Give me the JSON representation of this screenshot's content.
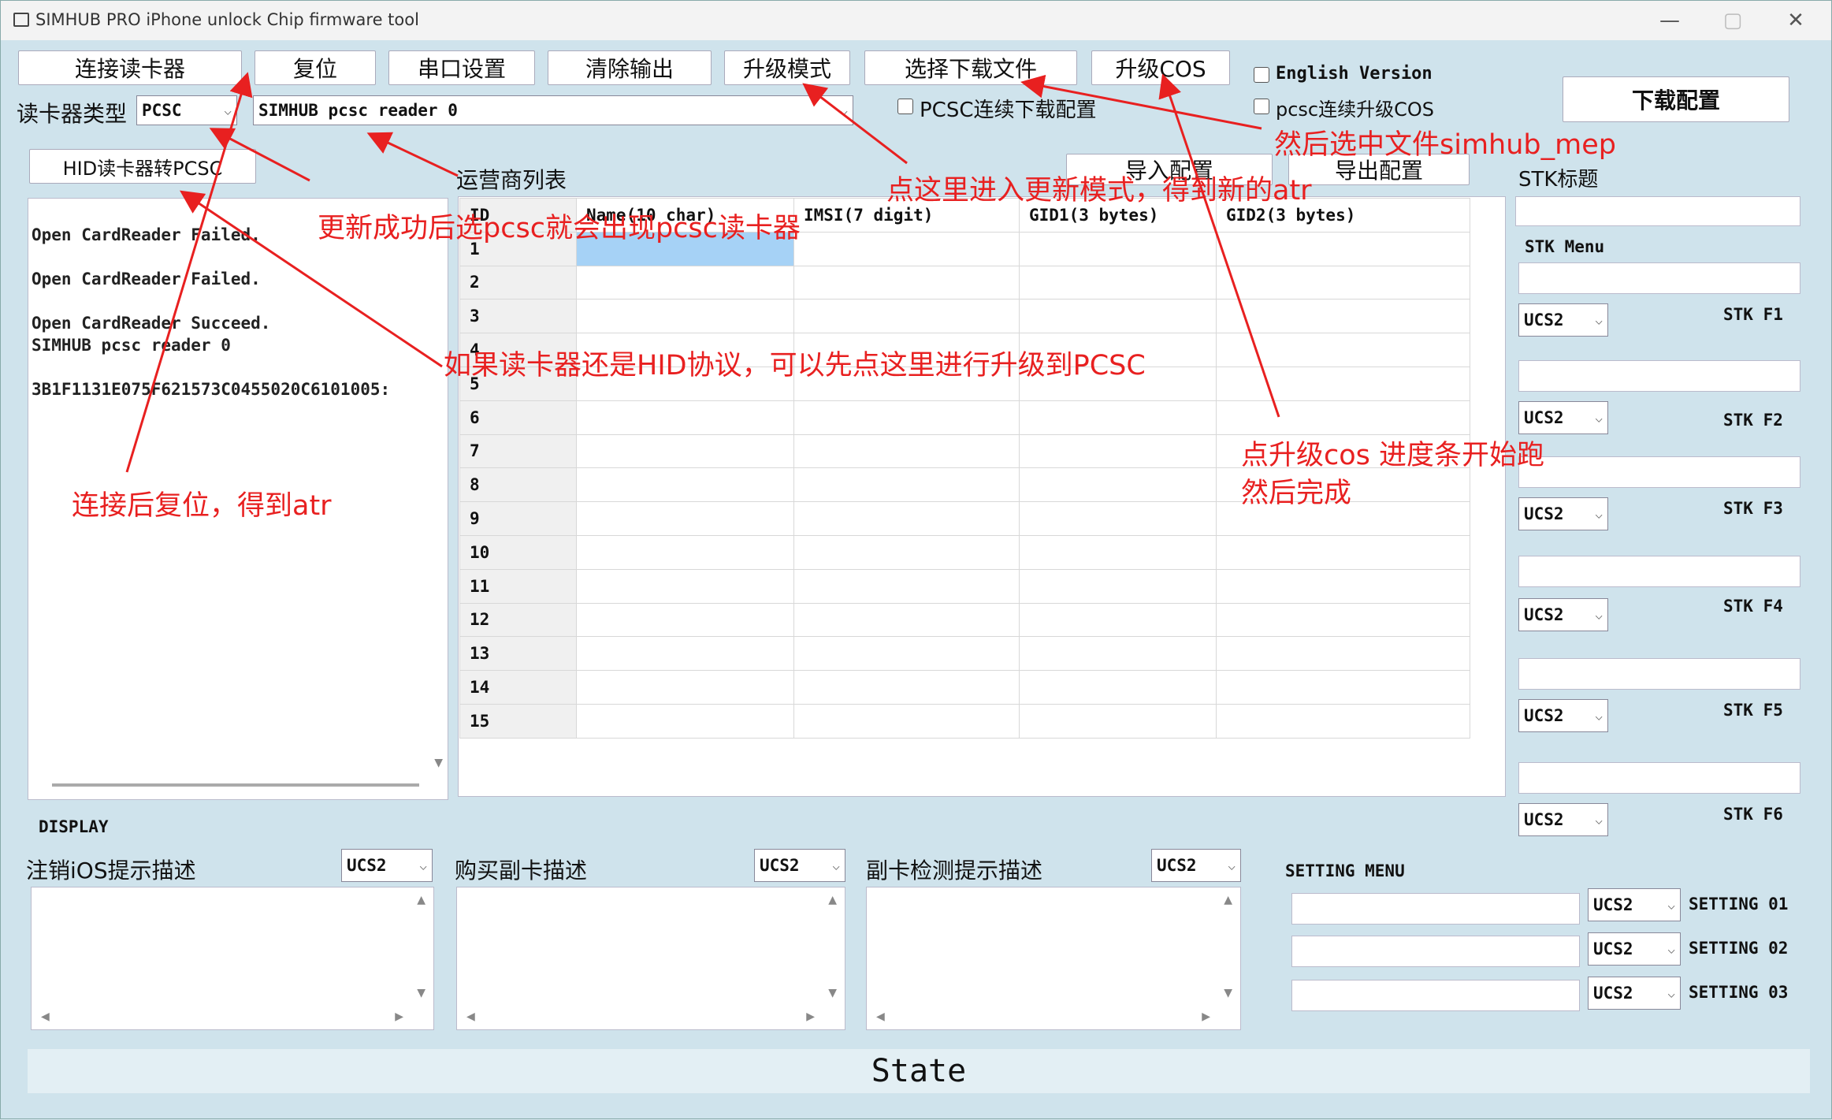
{
  "window": {
    "title": "SIMHUB PRO iPhone unlock Chip firmware tool",
    "controls": [
      "—",
      "▢",
      "✕"
    ]
  },
  "toolbar": {
    "connect": "连接读卡器",
    "reset": "复位",
    "serial": "串口设置",
    "clear": "清除输出",
    "upgrade_mode": "升级模式",
    "select_file": "选择下载文件",
    "upgrade_cos": "升级COS",
    "english_version": "English Version",
    "pcsc_continuous_cos": "pcsc连续升级COS",
    "download_config": "下载配置",
    "pcsc_continuous_download": "PCSC连续下载配置"
  },
  "reader": {
    "type_label": "读卡器类型",
    "type_value": "PCSC",
    "reader_value": "SIMHUB pcsc reader 0",
    "hid_button": "HID读卡器转PCSC"
  },
  "operator": {
    "label": "运营商列表",
    "import": "导入配置",
    "export": "导出配置",
    "columns": [
      "ID",
      "Name(10 char)",
      "IMSI(7 digit)",
      "GID1(3 bytes)",
      "GID2(3 bytes)"
    ],
    "rows": [
      "1",
      "2",
      "3",
      "4",
      "5",
      "6",
      "7",
      "8",
      "9",
      "10",
      "11",
      "12",
      "13",
      "14",
      "15"
    ]
  },
  "log": {
    "lines": [
      "Open CardReader Failed.",
      "Open CardReader Failed.",
      "Open CardReader Succeed.",
      "SIMHUB pcsc reader 0",
      "3B1F1131E075F621573C0455020C6101005:"
    ]
  },
  "stk": {
    "title_label": "STK标题",
    "menu_label": "STK Menu",
    "encoding": "UCS2",
    "items": [
      "STK F1",
      "STK F2",
      "STK F3",
      "STK F4",
      "STK F5",
      "STK F6"
    ]
  },
  "display": {
    "label": "DISPLAY",
    "sections": [
      {
        "label": "注销iOS提示描述",
        "encoding": "UCS2"
      },
      {
        "label": "购买副卡描述",
        "encoding": "UCS2"
      },
      {
        "label": "副卡检测提示描述",
        "encoding": "UCS2"
      }
    ]
  },
  "setting": {
    "label": "SETTING MENU",
    "encoding": "UCS2",
    "items": [
      "SETTING 01",
      "SETTING 02",
      "SETTING 03"
    ]
  },
  "status": {
    "text": "State"
  },
  "annotations": {
    "a1": "然后选中文件simhub_mep",
    "a2": "点这里进入更新模式，得到新的atr",
    "a3": "更新成功后选pcsc就会出现pcsc读卡器",
    "a4": "如果读卡器还是HID协议，可以先点这里进行升级到PCSC",
    "a5_line1": "点升级cos 进度条开始跑",
    "a5_line2": "然后完成",
    "a6": "连接后复位，得到atr"
  },
  "colors": {
    "annotation": "#e82020",
    "window_bg": "#cfe3ec",
    "selected_cell": "#a6d2f6"
  }
}
